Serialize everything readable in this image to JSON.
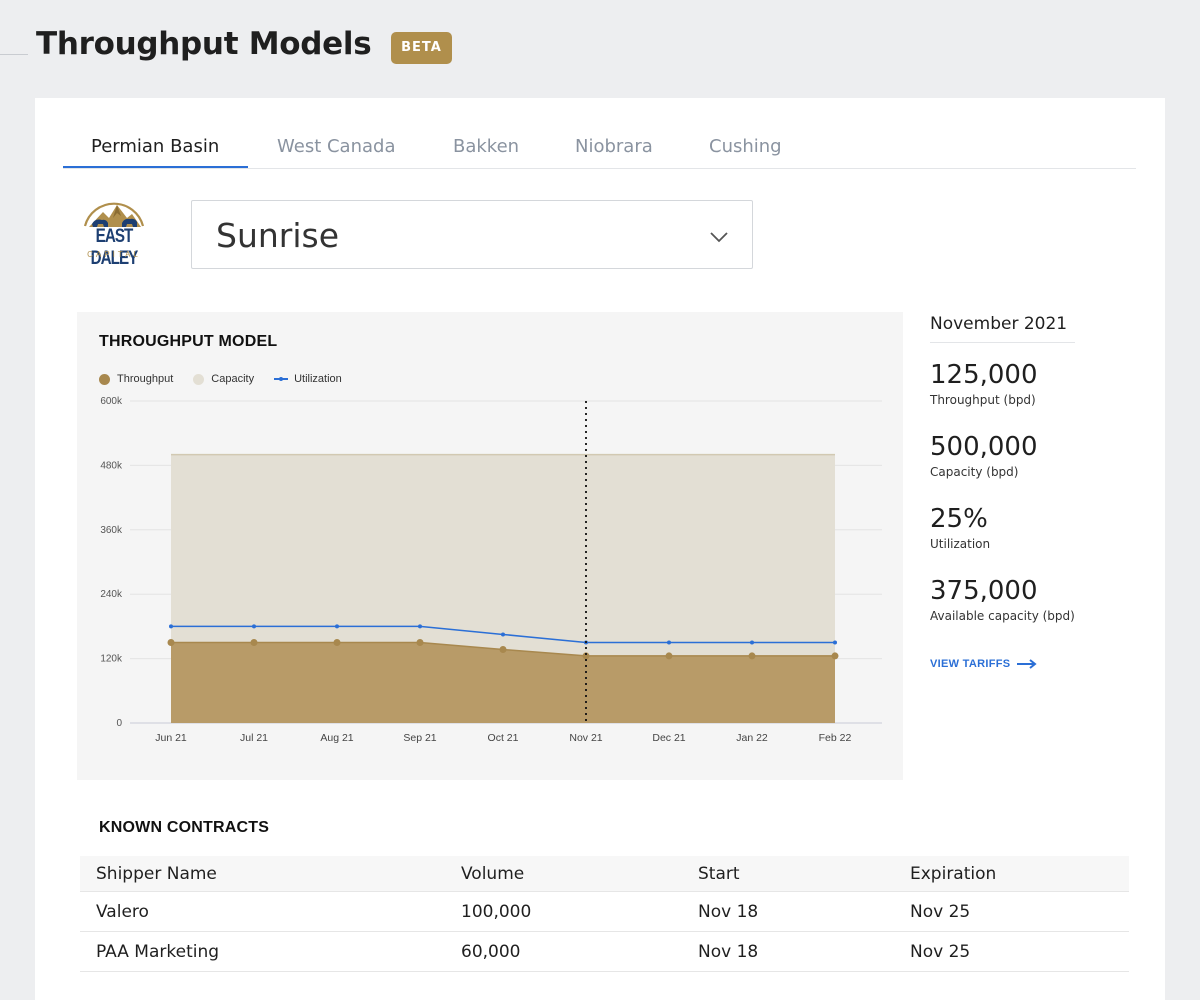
{
  "page": {
    "title": "Throughput Models",
    "badge": "BETA"
  },
  "tabs": [
    {
      "label": "Permian Basin",
      "active": true
    },
    {
      "label": "West Canada",
      "active": false
    },
    {
      "label": "Bakken",
      "active": false
    },
    {
      "label": "Niobrara",
      "active": false
    },
    {
      "label": "Cushing",
      "active": false
    }
  ],
  "logo": {
    "line1": "EAST DALEY",
    "line2": "CAPITAL"
  },
  "pipeline_select": {
    "value": "Sunrise",
    "icon": "chevron-down-icon"
  },
  "chart_panel": {
    "title": "THROUGHPUT MODEL",
    "legend": [
      "Throughput",
      "Capacity",
      "Utilization"
    ]
  },
  "chart_data": {
    "type": "area",
    "title": "THROUGHPUT MODEL",
    "categories": [
      "Jun 21",
      "Jul 21",
      "Aug 21",
      "Sep 21",
      "Oct 21",
      "Nov 21",
      "Dec 21",
      "Jan 22",
      "Feb 22"
    ],
    "y_ticks": [
      "0",
      "120k",
      "240k",
      "360k",
      "480k",
      "600k"
    ],
    "ylim": [
      0,
      600000
    ],
    "grid": true,
    "legend_position": "top-left",
    "highlighted_category": "Nov 21",
    "colors": {
      "throughput": "#b89b68",
      "throughput_marker": "#a8884e",
      "capacity": "#e3dfd4",
      "utilization": "#2b6fd6"
    },
    "series": [
      {
        "name": "Throughput",
        "kind": "area",
        "values": [
          150000,
          150000,
          150000,
          150000,
          137000,
          125000,
          125000,
          125000,
          125000
        ]
      },
      {
        "name": "Capacity",
        "kind": "area",
        "values": [
          500000,
          500000,
          500000,
          500000,
          500000,
          500000,
          500000,
          500000,
          500000
        ]
      },
      {
        "name": "Utilization",
        "kind": "line",
        "values": [
          180000,
          180000,
          180000,
          180000,
          165000,
          150000,
          150000,
          150000,
          150000
        ]
      }
    ]
  },
  "stats": {
    "period": "November 2021",
    "items": [
      {
        "value": "125,000",
        "label": "Throughput (bpd)"
      },
      {
        "value": "500,000",
        "label": "Capacity (bpd)"
      },
      {
        "value": "25%",
        "label": "Utilization"
      },
      {
        "value": "375,000",
        "label": "Available capacity (bpd)"
      }
    ],
    "link": "VIEW TARIFFS"
  },
  "contracts": {
    "title": "KNOWN CONTRACTS",
    "columns": [
      "Shipper Name",
      "Volume",
      "Start",
      "Expiration"
    ],
    "rows": [
      [
        "Valero",
        "100,000",
        "Nov 18",
        "Nov 25"
      ],
      [
        "PAA Marketing",
        "60,000",
        "Nov 18",
        "Nov 25"
      ]
    ]
  }
}
